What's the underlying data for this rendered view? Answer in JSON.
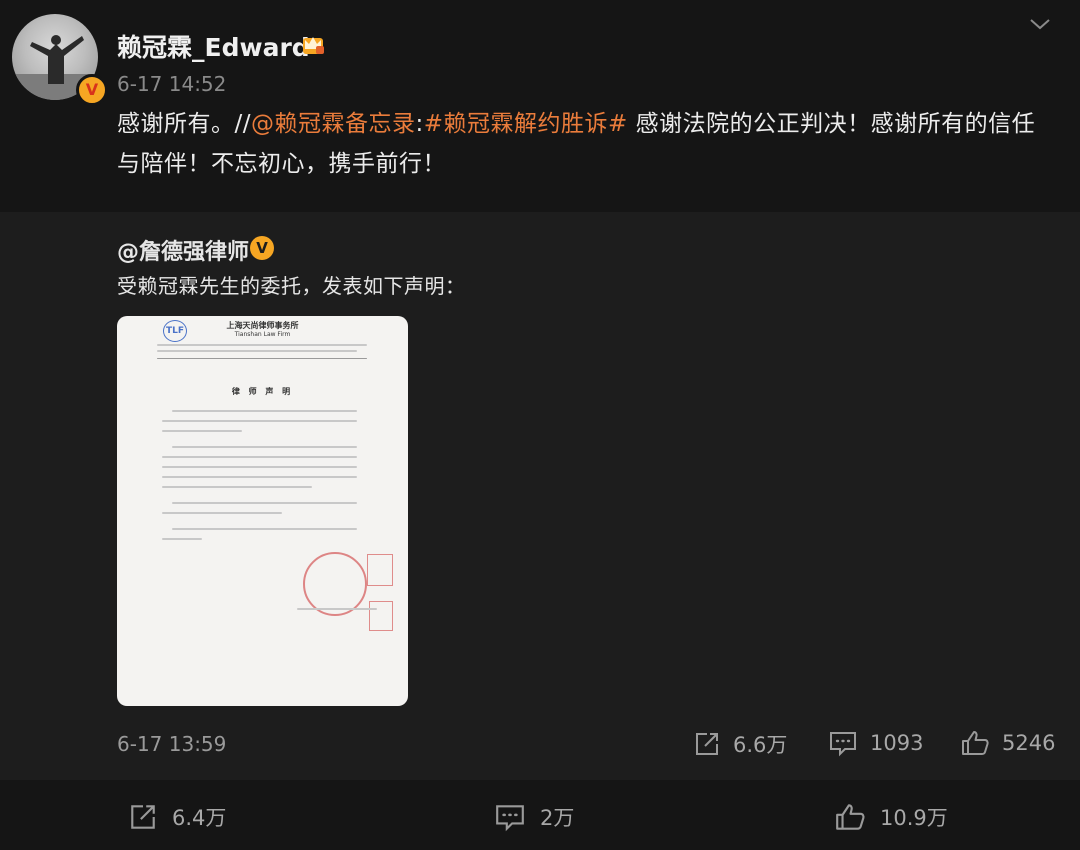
{
  "post": {
    "username": "赖冠霖_Edward",
    "timestamp": "6-17 14:52",
    "text_plain": "感谢所有。//",
    "mention": "@赖冠霖备忘录",
    "separator": ":",
    "hashtag": "#赖冠霖解约胜诉#",
    "text_tail": " 感谢法院的公正判决！感谢所有的信任与陪伴！不忘初心，携手前行！",
    "verified_badge": "V"
  },
  "repost": {
    "author": "@詹德强律师",
    "verified_badge": "V",
    "text": "受赖冠霖先生的委托，发表如下声明：",
    "image": {
      "firm_name": "上海天尚律师事务所",
      "firm_name_en": "Tianshan Law Firm",
      "doc_title": "律 师 声 明",
      "logo_text": "TLF"
    },
    "timestamp": "6-17 13:59",
    "stats": {
      "reposts": "6.6万",
      "comments": "1093",
      "likes": "5246"
    }
  },
  "footer": {
    "reposts": "6.4万",
    "comments": "2万",
    "likes": "10.9万"
  },
  "icons": {
    "repost": "repost-icon",
    "comment": "comment-icon",
    "like": "like-icon",
    "crown": "crown-icon",
    "chevron": "chevron-down-icon"
  },
  "colors": {
    "accent_link": "#ea7c3b",
    "verified": "#f6a623",
    "background": "#151515",
    "repost_bg": "#1d1d1d"
  }
}
